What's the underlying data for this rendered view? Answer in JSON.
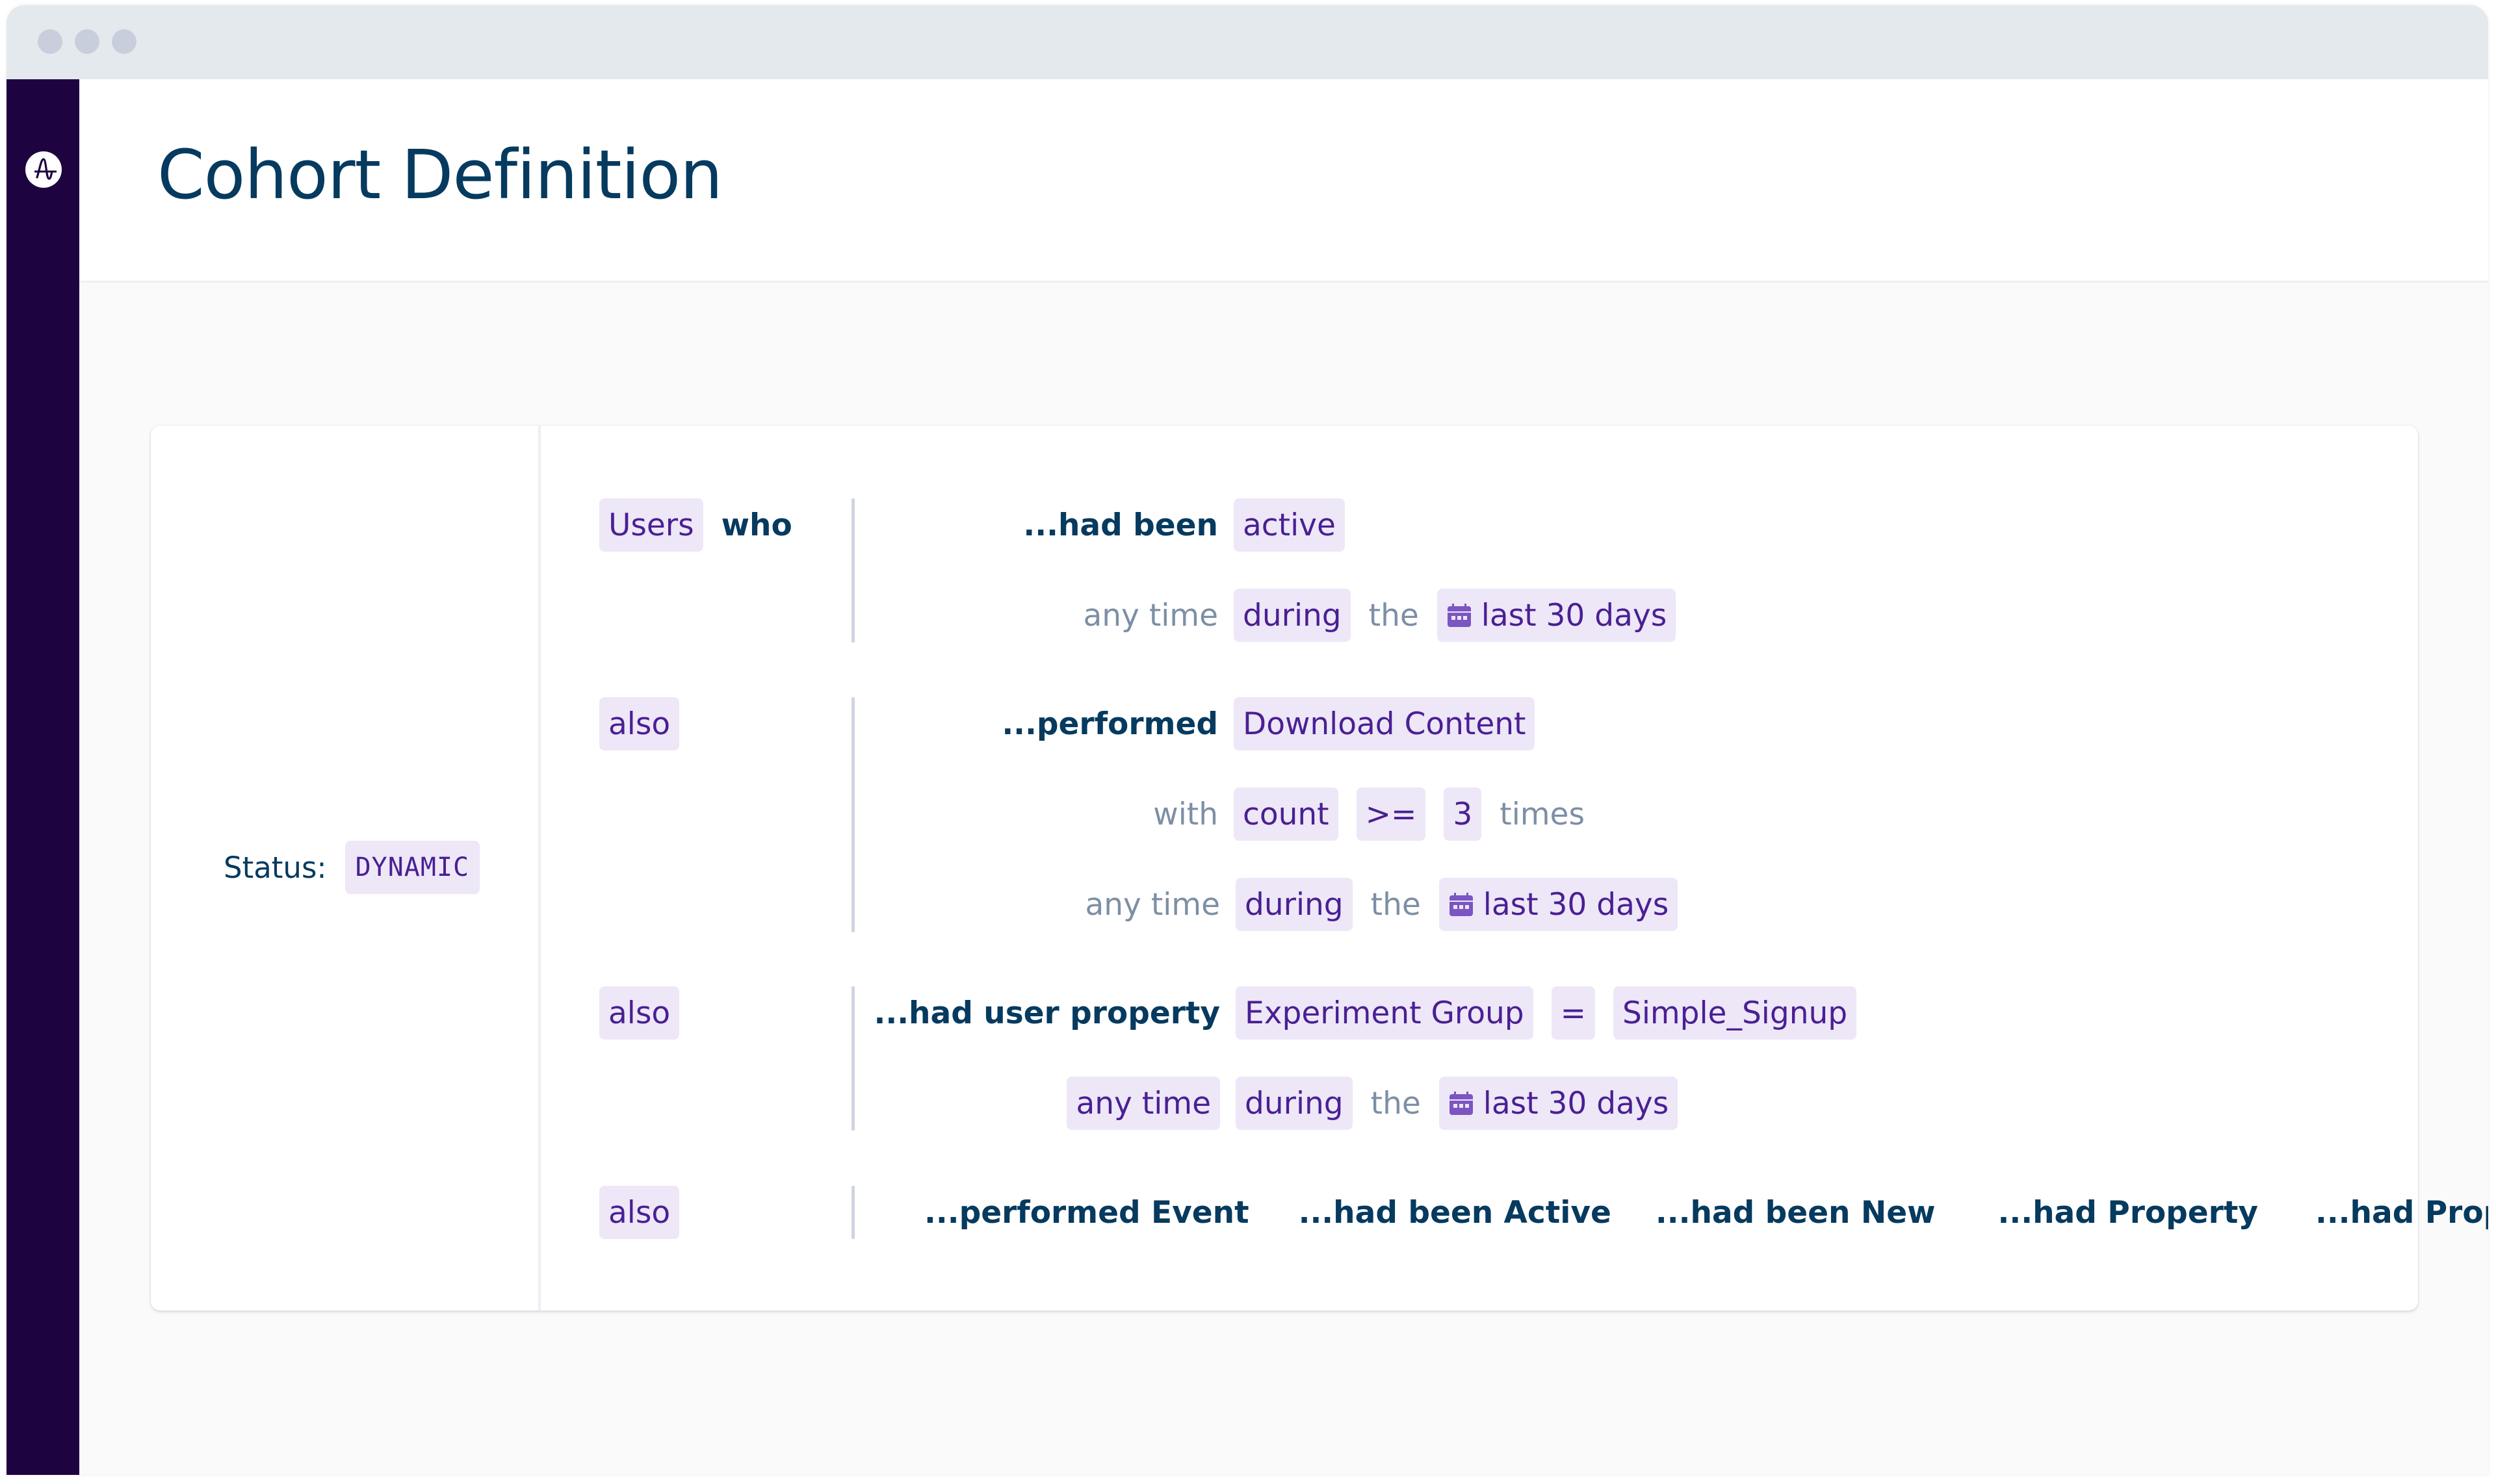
{
  "page": {
    "title": "Cohort Definition"
  },
  "colors": {
    "sidebar": "#1e0341",
    "title": "#063a5f",
    "pill_bg": "#ede7f7",
    "pill_text": "#4a1f93",
    "muted_text": "#7d8fa5",
    "calendar_icon": "#7b55c2"
  },
  "status": {
    "label": "Status:",
    "value": "DYNAMIC"
  },
  "rows": [
    {
      "left": {
        "pill": "Users",
        "text": "who"
      },
      "lines": [
        {
          "label": "...had been",
          "parts": [
            {
              "type": "pill",
              "text": "active"
            }
          ]
        },
        {
          "label": "any time",
          "parts": [
            {
              "type": "pill",
              "text": "during"
            },
            {
              "type": "text",
              "text": "the"
            },
            {
              "type": "date-pill",
              "icon": "calendar-icon",
              "text": "last 30 days"
            }
          ]
        }
      ]
    },
    {
      "left": {
        "pill": "also"
      },
      "lines": [
        {
          "label": "...performed",
          "parts": [
            {
              "type": "pill",
              "text": "Download Content"
            }
          ]
        },
        {
          "label": "with",
          "parts": [
            {
              "type": "pill",
              "text": "count"
            },
            {
              "type": "pill",
              "text": ">="
            },
            {
              "type": "pill",
              "text": "3"
            },
            {
              "type": "text",
              "text": "times"
            }
          ]
        },
        {
          "label": "any time",
          "parts": [
            {
              "type": "pill",
              "text": "during"
            },
            {
              "type": "text",
              "text": "the"
            },
            {
              "type": "date-pill",
              "icon": "calendar-icon",
              "text": "last 30 days"
            }
          ]
        }
      ]
    },
    {
      "left": {
        "pill": "also"
      },
      "lines": [
        {
          "label": "...had user property",
          "parts": [
            {
              "type": "pill",
              "text": "Experiment Group"
            },
            {
              "type": "pill",
              "text": "="
            },
            {
              "type": "pill",
              "text": "Simple_Signup"
            }
          ]
        },
        {
          "label_pill": "any time",
          "parts": [
            {
              "type": "pill",
              "text": "during"
            },
            {
              "type": "text",
              "text": "the"
            },
            {
              "type": "date-pill",
              "icon": "calendar-icon",
              "text": "last 30 days"
            }
          ]
        }
      ]
    },
    {
      "left": {
        "pill": "also"
      },
      "options": [
        "...performed Event",
        "...had been Active",
        "...had been New",
        "...had Property",
        "...had Propensity"
      ]
    }
  ]
}
